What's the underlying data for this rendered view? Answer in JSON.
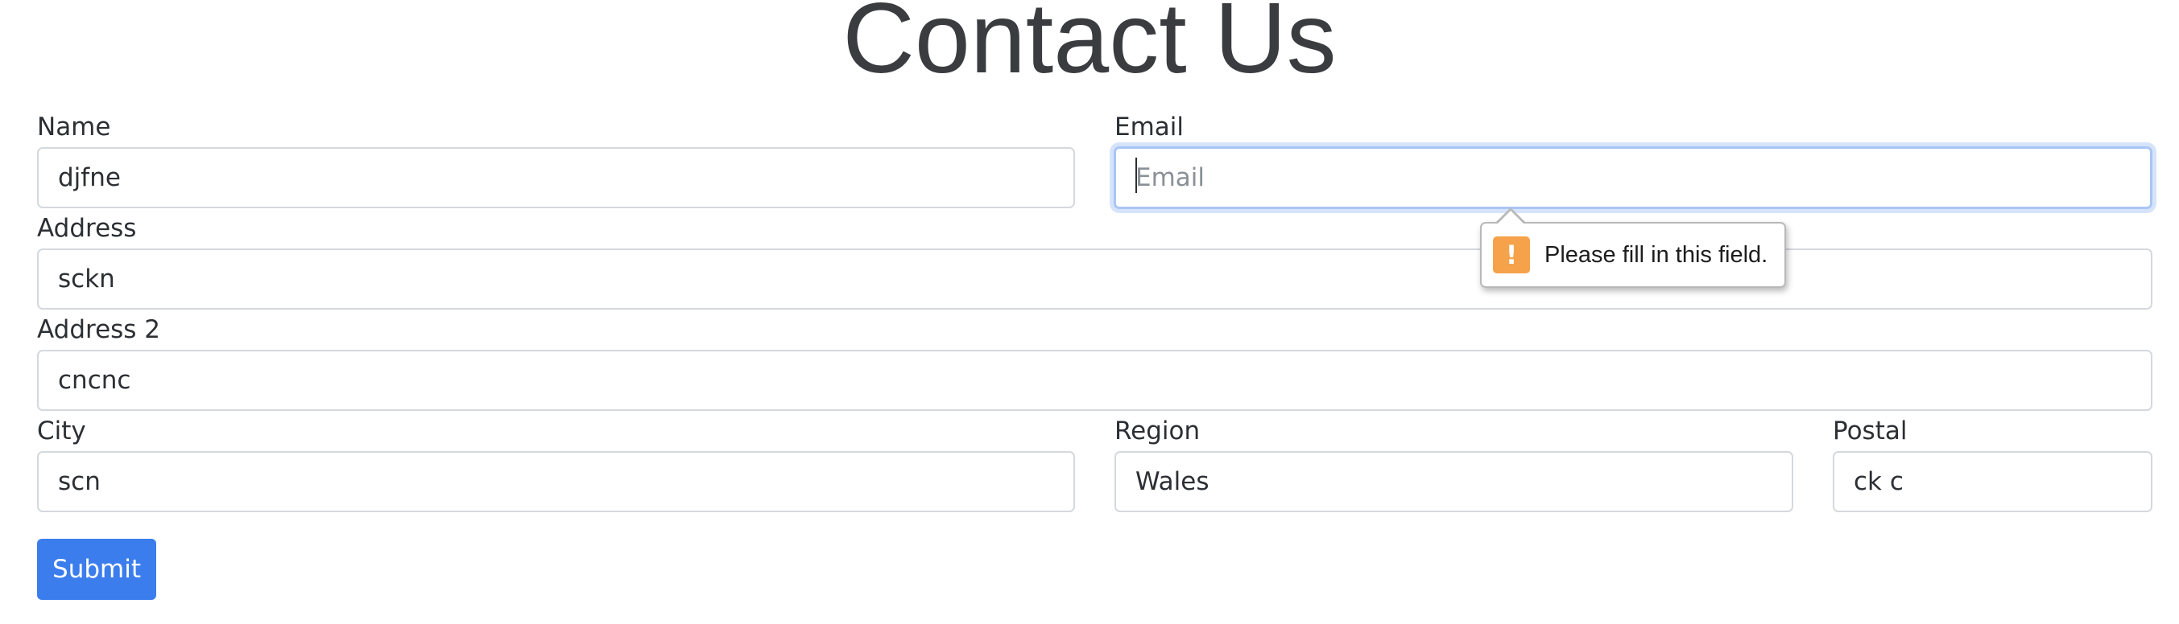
{
  "page": {
    "title": "Contact Us"
  },
  "form": {
    "name": {
      "label": "Name",
      "value": "djfne",
      "placeholder": ""
    },
    "email": {
      "label": "Email",
      "value": "",
      "placeholder": "Email"
    },
    "address": {
      "label": "Address",
      "value": "sckn",
      "placeholder": ""
    },
    "address2": {
      "label": "Address 2",
      "value": "cncnc",
      "placeholder": ""
    },
    "city": {
      "label": "City",
      "value": "scn",
      "placeholder": ""
    },
    "region": {
      "label": "Region",
      "value": "Wales",
      "placeholder": ""
    },
    "postal": {
      "label": "Postal",
      "value": "ck c",
      "placeholder": ""
    },
    "submit_label": "Submit"
  },
  "validation": {
    "message": "Please fill in this field.",
    "icon": "warning-icon",
    "icon_glyph": "!",
    "icon_color": "#f6a24a"
  },
  "colors": {
    "accent": "#3b7ded",
    "focus_ring": "#a9c6f5"
  }
}
